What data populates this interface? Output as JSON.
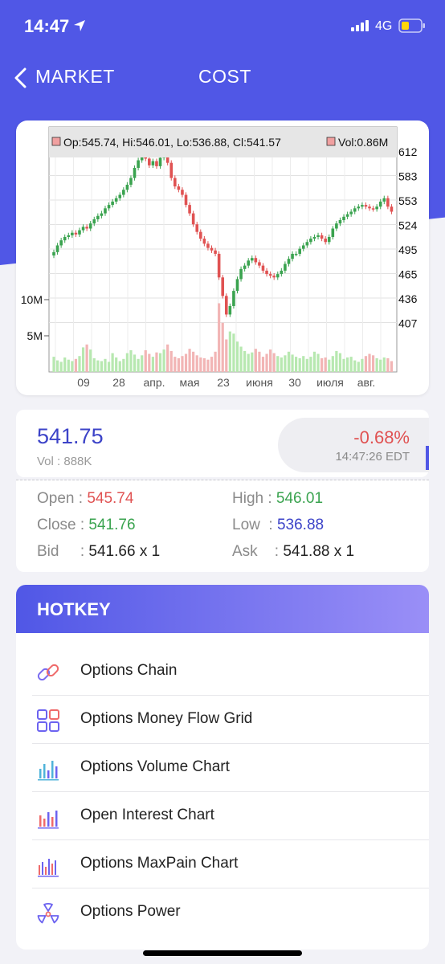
{
  "status_bar": {
    "time": "14:47",
    "network": "4G"
  },
  "nav": {
    "back_label": "MARKET",
    "title": "COST"
  },
  "chart": {
    "ohlc_summary": "Op:545.74, Hi:546.01, Lo:536.88, Cl:541.57",
    "vol_summary": "Vol:0.86M"
  },
  "chart_data": {
    "type": "candlestick",
    "price_axis_ticks": [
      "612",
      "583",
      "553",
      "524",
      "495",
      "465",
      "436",
      "407"
    ],
    "price_ylim": [
      407,
      612
    ],
    "volume_axis_ticks": [
      "10M",
      "5M"
    ],
    "x_tick_labels": [
      "09",
      "28",
      "апр.",
      "мая",
      "23",
      "июня",
      "30",
      "июля",
      "авг."
    ],
    "close_series": [
      492,
      500,
      506,
      510,
      512,
      515,
      513,
      518,
      522,
      520,
      526,
      531,
      535,
      538,
      544,
      548,
      552,
      556,
      560,
      566,
      572,
      580,
      592,
      601,
      612,
      603,
      595,
      600,
      594,
      604,
      611,
      598,
      580,
      570,
      566,
      560,
      548,
      538,
      525,
      516,
      508,
      502,
      497,
      494,
      490,
      462,
      440,
      418,
      428,
      446,
      460,
      472,
      476,
      482,
      485,
      480,
      476,
      470,
      466,
      464,
      462,
      466,
      470,
      478,
      484,
      490,
      490,
      496,
      500,
      504,
      508,
      510,
      512,
      508,
      504,
      510,
      520,
      526,
      530,
      534,
      537,
      540,
      544,
      546,
      548,
      546,
      544,
      543,
      546,
      552,
      556,
      546,
      540
    ],
    "volume_millions": [
      2.1,
      1.6,
      1.4,
      2.0,
      1.7,
      1.5,
      1.8,
      2.2,
      3.4,
      3.8,
      3.1,
      1.9,
      1.6,
      1.5,
      1.8,
      1.4,
      2.6,
      2.0,
      1.5,
      1.8,
      2.6,
      3.0,
      2.4,
      1.8,
      2.3,
      3.0,
      2.5,
      2.1,
      2.7,
      2.6,
      3.1,
      3.8,
      2.9,
      2.1,
      1.9,
      2.2,
      2.5,
      3.2,
      2.8,
      2.3,
      2.0,
      1.9,
      1.7,
      2.1,
      2.8,
      9.5,
      6.8,
      4.5,
      5.6,
      5.3,
      4.2,
      3.5,
      2.9,
      2.5,
      2.7,
      3.2,
      2.8,
      2.1,
      2.5,
      3.1,
      2.6,
      2.2,
      2.0,
      2.3,
      2.8,
      2.4,
      2.1,
      1.9,
      2.2,
      1.8,
      2.1,
      2.8,
      2.5,
      1.9,
      2.0,
      1.7,
      2.2,
      2.9,
      2.6,
      1.8,
      2.0,
      2.1,
      1.6,
      1.4,
      1.8,
      2.2,
      2.5,
      2.3,
      1.9,
      1.7,
      2.0,
      1.9,
      1.5
    ]
  },
  "quote": {
    "price": "541.75",
    "volume": "Vol : 888K",
    "change_pct": "-0.68%",
    "timestamp": "14:47:26 EDT"
  },
  "details": {
    "open_label": "Open : ",
    "open_value": "545.74",
    "high_label": "High : ",
    "high_value": "546.01",
    "close_label": "Close : ",
    "close_value": "541.76",
    "low_label": "Low  : ",
    "low_value": "536.88",
    "bid_label": "Bid     : ",
    "bid_value": "541.66 x 1",
    "ask_label": "Ask    : ",
    "ask_value": "541.88 x 1"
  },
  "hotkey": {
    "title": "HOTKEY",
    "items": [
      {
        "label": "Options Chain",
        "icon": "link-icon"
      },
      {
        "label": "Options Money Flow Grid",
        "icon": "grid-icon"
      },
      {
        "label": "Options Volume Chart",
        "icon": "bar-chart-icon"
      },
      {
        "label": "Open Interest Chart",
        "icon": "bar-chart-icon"
      },
      {
        "label": "Options MaxPain Chart",
        "icon": "bar-chart-icon"
      },
      {
        "label": "Options Power",
        "icon": "radiation-icon"
      }
    ]
  },
  "colors": {
    "brand": "#5057e6",
    "up": "#3aa34f",
    "down": "#e05252",
    "price_text": "#3c43c8"
  }
}
